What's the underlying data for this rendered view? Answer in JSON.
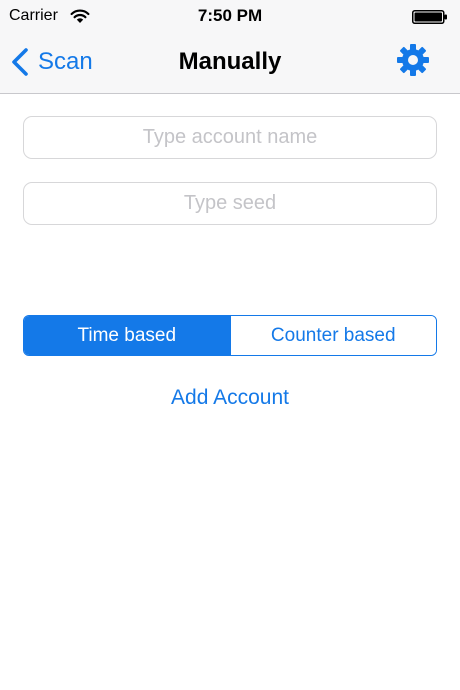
{
  "status_bar": {
    "carrier": "Carrier",
    "time": "7:50 PM",
    "wifi_icon": "wifi-icon",
    "battery_icon": "battery-icon"
  },
  "nav_bar": {
    "back_label": "Scan",
    "title": "Manually",
    "settings_icon": "gear-icon"
  },
  "form": {
    "account_name": {
      "value": "",
      "placeholder": "Type account name"
    },
    "seed": {
      "value": "",
      "placeholder": "Type seed"
    }
  },
  "type_selector": {
    "options": [
      "Time based",
      "Counter based"
    ],
    "selected": "Time based"
  },
  "add_account_label": "Add Account",
  "colors": {
    "accent": "#1479e8",
    "navbar_bg": "#f7f7f8",
    "placeholder": "#c4c4c8"
  }
}
